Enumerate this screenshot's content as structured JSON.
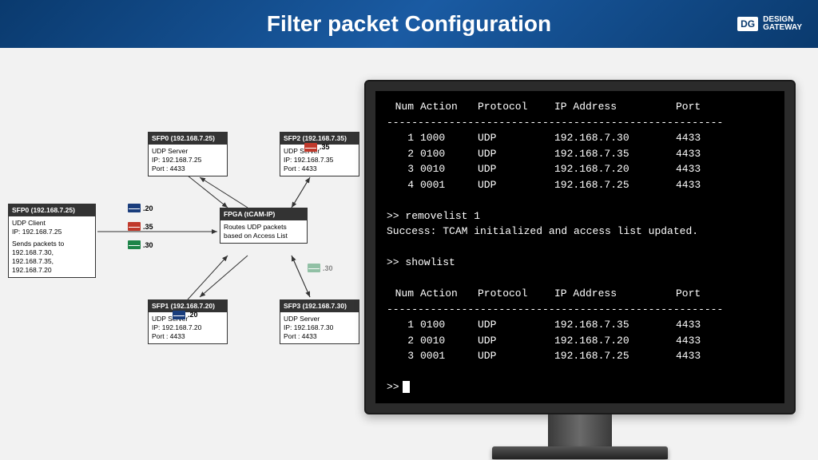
{
  "header": {
    "title": "Filter packet Configuration",
    "brand_abbr": "DG",
    "brand_line1": "DESIGN",
    "brand_line2": "GATEWAY"
  },
  "diagram": {
    "client": {
      "title": "SFP0 (192.168.7.25)",
      "role": "UDP Client",
      "ip": "IP: 192.168.7.25",
      "note": "Sends packets to",
      "dest1": "192.168.7.30,",
      "dest2": "192.168.7.35,",
      "dest3": "192.168.7.20"
    },
    "sfp0": {
      "title": "SFP0 (192.168.7.25)",
      "role": "UDP Server",
      "ip": "IP: 192.168.7.25",
      "port": "Port : 4433"
    },
    "sfp1": {
      "title": "SFP1 (192.168.7.20)",
      "role": "UDP Server",
      "ip": "IP: 192.168.7.20",
      "port": "Port : 4433",
      "badge": ".20"
    },
    "sfp2": {
      "title": "SFP2 (192.168.7.35)",
      "role": "UDP Server",
      "ip": "IP: 192.168.7.35",
      "port": "Port : 4433",
      "badge": ".35"
    },
    "sfp3": {
      "title": "SFP3 (192.168.7.30)",
      "role": "UDP Server",
      "ip": "IP: 192.168.7.30",
      "port": "Port : 4433"
    },
    "fpga": {
      "title": "FPGA (tCAM-IP)",
      "desc": "Routes UDP packets based on Access List"
    },
    "envelopes": {
      "blue": ".20",
      "red": ".35",
      "green": ".30",
      "faded": ".30"
    }
  },
  "terminal": {
    "headers": {
      "num": "Num",
      "action": "Action",
      "protocol": "Protocol",
      "ip": "IP Address",
      "port": "Port"
    },
    "divider": "------------------------------------------------------",
    "table1": [
      {
        "num": "1",
        "action": "1000",
        "protocol": "UDP",
        "ip": "192.168.7.30",
        "port": "4433"
      },
      {
        "num": "2",
        "action": "0100",
        "protocol": "UDP",
        "ip": "192.168.7.35",
        "port": "4433"
      },
      {
        "num": "3",
        "action": "0010",
        "protocol": "UDP",
        "ip": "192.168.7.20",
        "port": "4433"
      },
      {
        "num": "4",
        "action": "0001",
        "protocol": "UDP",
        "ip": "192.168.7.25",
        "port": "4433"
      }
    ],
    "cmd1": ">> removelist 1",
    "msg1": "Success: TCAM initialized and access list updated.",
    "cmd2": ">> showlist",
    "table2": [
      {
        "num": "1",
        "action": "0100",
        "protocol": "UDP",
        "ip": "192.168.7.35",
        "port": "4433"
      },
      {
        "num": "2",
        "action": "0010",
        "protocol": "UDP",
        "ip": "192.168.7.20",
        "port": "4433"
      },
      {
        "num": "3",
        "action": "0001",
        "protocol": "UDP",
        "ip": "192.168.7.25",
        "port": "4433"
      }
    ],
    "prompt": ">>"
  }
}
